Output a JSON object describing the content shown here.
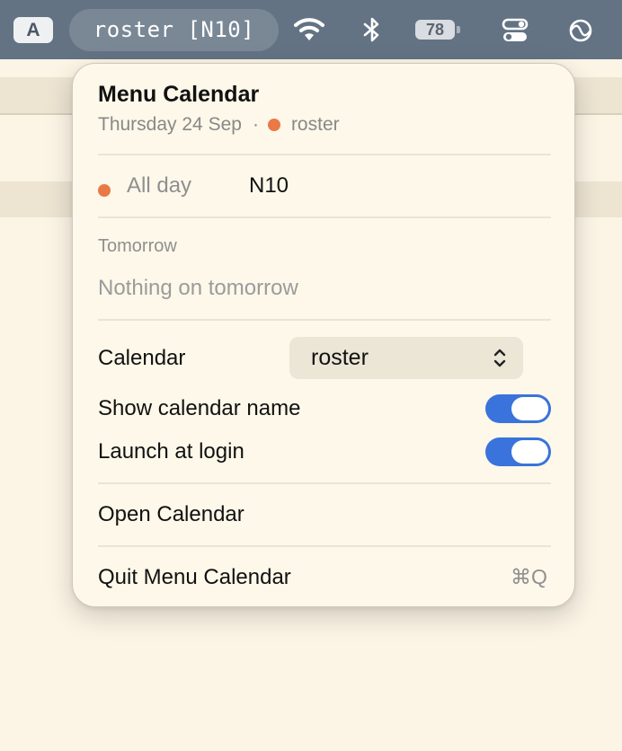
{
  "menubar": {
    "input_source": "A",
    "status_item": "roster [N10]",
    "battery_level": "78",
    "icons": [
      "wifi-icon",
      "bluetooth-icon",
      "battery-icon",
      "control-center-icon",
      "sync-icon"
    ]
  },
  "popover": {
    "title": "Menu Calendar",
    "date": "Thursday 24 Sep",
    "separator": "·",
    "calendar_name": "roster",
    "accent_color": "#e97a47",
    "event": {
      "time": "All day",
      "title": "N10"
    },
    "tomorrow": {
      "heading": "Tomorrow",
      "empty_text": "Nothing on tomorrow"
    },
    "settings": {
      "calendar_label": "Calendar",
      "calendar_value": "roster",
      "show_name_label": "Show calendar name",
      "show_name_on": true,
      "launch_login_label": "Launch at login",
      "launch_login_on": true,
      "toggle_color": "#3a73db"
    },
    "open_calendar": "Open Calendar",
    "quit_label": "Quit Menu Calendar",
    "quit_shortcut": "⌘Q"
  }
}
